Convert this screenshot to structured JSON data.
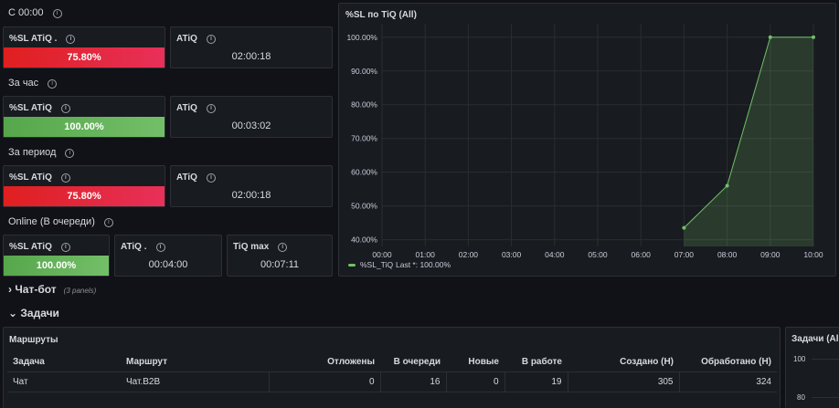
{
  "sections": {
    "s1": "С 00:00",
    "s2": "За час",
    "s3": "За период",
    "s4": "Online (В очереди)"
  },
  "stats": {
    "s1_sl": {
      "title": "%SL ATiQ .",
      "value": "75.80%"
    },
    "s1_atiq": {
      "title": "ATiQ",
      "value": "02:00:18"
    },
    "s2_sl": {
      "title": "%SL ATiQ",
      "value": "100.00%"
    },
    "s2_atiq": {
      "title": "ATiQ",
      "value": "00:03:02"
    },
    "s3_sl": {
      "title": "%SL ATiQ",
      "value": "75.80%"
    },
    "s3_atiq": {
      "title": "ATiQ",
      "value": "02:00:18"
    },
    "s4_sl": {
      "title": "%SL ATiQ",
      "value": "100.00%"
    },
    "s4_atiq": {
      "title": "ATiQ .",
      "value": "00:04:00"
    },
    "s4_tiq": {
      "title": "TiQ max",
      "value": "00:07:11"
    }
  },
  "colors": {
    "red": "#e0226e",
    "green": "#73bf69",
    "bg": "#111217",
    "panel": "#181b1f"
  },
  "rows": {
    "chatbot": {
      "arrow": "›",
      "label": "Чат-бот",
      "sub": "(3 panels)"
    },
    "tasks": {
      "arrow": "⌄",
      "label": "Задачи"
    }
  },
  "routes": {
    "title": "Маршруты",
    "columns": [
      "Задача",
      "Маршрут",
      "Отложены",
      "В очереди",
      "Новые",
      "В работе",
      "Создано (Н)",
      "Обработано (Н)"
    ],
    "rows": [
      [
        "Чат",
        "Чат.B2B",
        "0",
        "16",
        "0",
        "19",
        "305",
        "324"
      ]
    ]
  },
  "tasks_panel": {
    "title": "Задачи (All",
    "y1": "100",
    "y2": "80"
  },
  "chart_data": {
    "type": "area",
    "title": "%SL по TiQ (All)",
    "x": [
      "00:00",
      "01:00",
      "02:00",
      "03:00",
      "04:00",
      "05:00",
      "06:00",
      "07:00",
      "08:00",
      "09:00",
      "10:00"
    ],
    "y_ticks": [
      "40.00%",
      "50.00%",
      "60.00%",
      "70.00%",
      "80.00%",
      "90.00%",
      "100.00%"
    ],
    "ylim": [
      38,
      104
    ],
    "series": [
      {
        "name": "%SL_TiQ",
        "color": "#73bf69",
        "points": [
          [
            "07:00",
            43.5
          ],
          [
            "08:00",
            56
          ],
          [
            "09:00",
            100
          ],
          [
            "10:00",
            100
          ]
        ]
      }
    ],
    "legend": {
      "label": "%SL_TiQ",
      "stat": "Last *: 100.00%",
      "position": "bottom-left"
    }
  }
}
